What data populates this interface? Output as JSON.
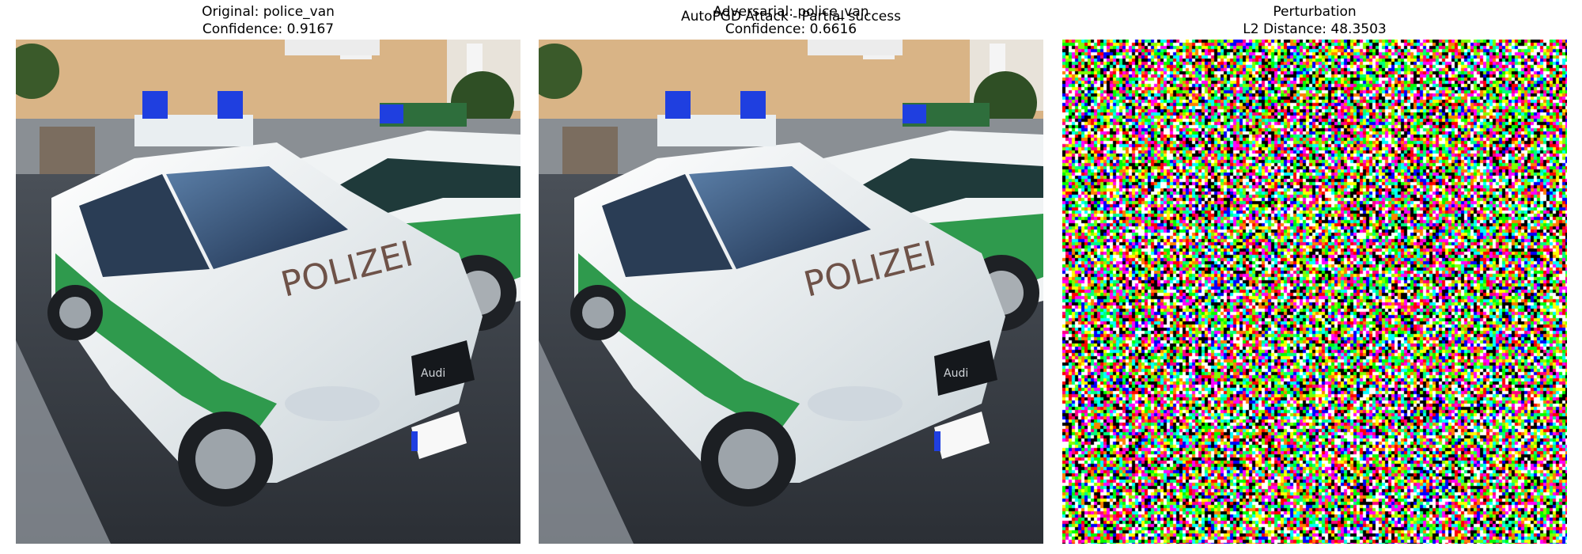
{
  "figure": {
    "title": "AutoPGD Attack - Partial success"
  },
  "panels": [
    {
      "title_line1": "Original: police_van",
      "title_line2": "Confidence: 0.9167",
      "image_subject": "police-car-photo"
    },
    {
      "title_line1": "Adversarial: police_van",
      "title_line2": "Confidence: 0.6616",
      "image_subject": "police-car-photo-perturbed"
    },
    {
      "title_line1": "Perturbation",
      "title_line2": "L2 Distance: 48.3503",
      "image_subject": "perturbation-noise"
    }
  ],
  "photo_text": {
    "hood_lettering": "POLIZEI",
    "grille_badge": "Audi"
  },
  "colors": {
    "police_green": "#2f9a4d",
    "car_white": "#eef2f3",
    "siren_blue": "#1f3fe0",
    "wall_tan": "#d9b486",
    "asphalt": "#3d4248"
  }
}
